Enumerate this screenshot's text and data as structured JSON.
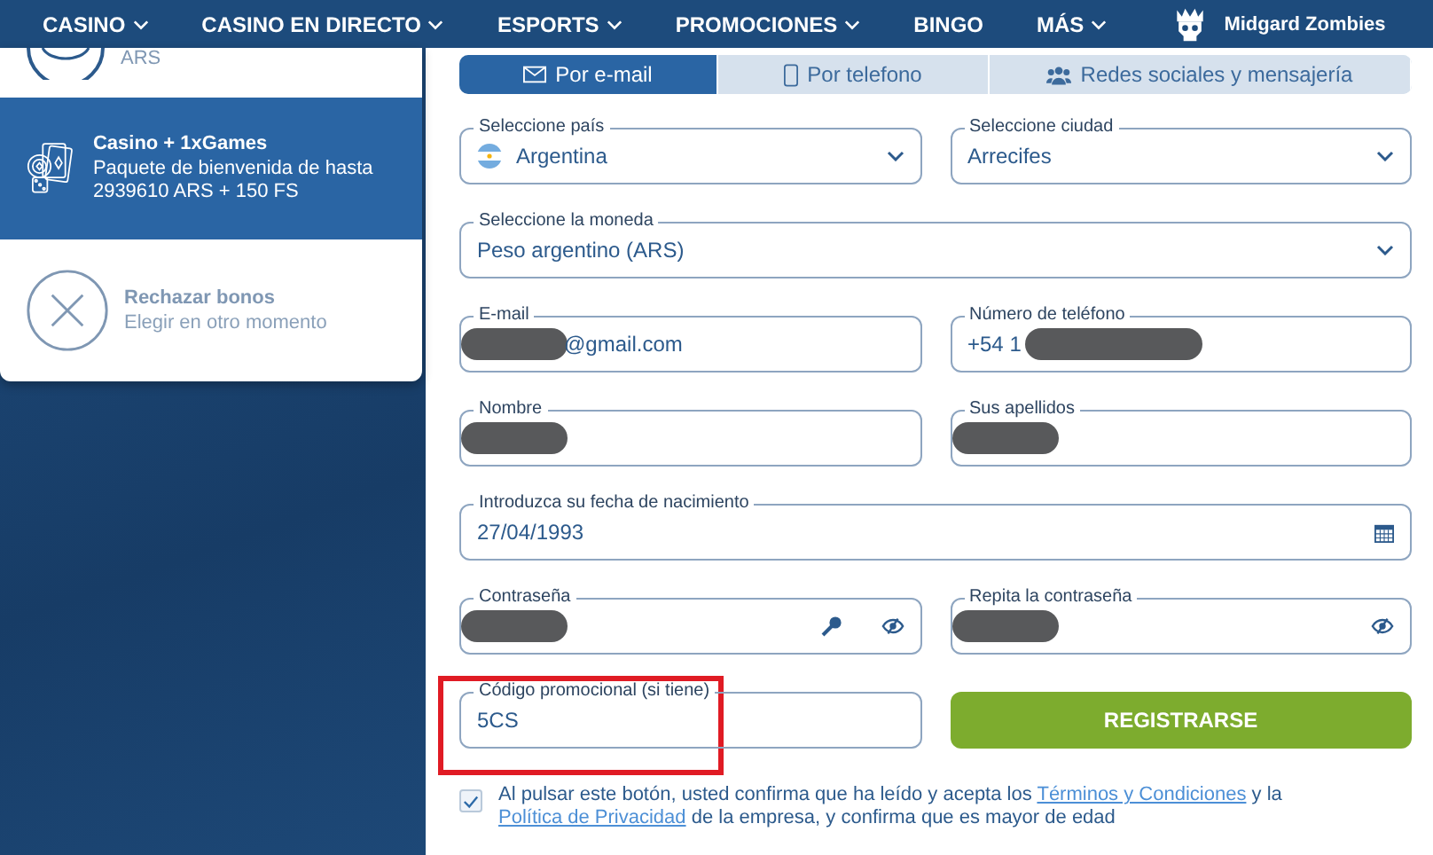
{
  "nav": {
    "items": [
      {
        "label": "CASINO",
        "dropdown": true
      },
      {
        "label": "CASINO EN DIRECTO",
        "dropdown": true
      },
      {
        "label": "ESPORTS",
        "dropdown": true
      },
      {
        "label": "PROMOCIONES",
        "dropdown": true
      },
      {
        "label": "BINGO",
        "dropdown": false
      },
      {
        "label": "MÁS",
        "dropdown": true
      }
    ],
    "brand": "Midgard Zombies"
  },
  "bonuses": [
    {
      "kind": "partial",
      "description": "ARS",
      "selected": false
    },
    {
      "kind": "casino",
      "title": "Casino + 1xGames",
      "description": "Paquete de bienvenida de hasta 2939610 ARS + 150 FS",
      "selected": true
    },
    {
      "kind": "reject",
      "title": "Rechazar bonos",
      "description": "Elegir en otro momento",
      "selected": false
    }
  ],
  "tabs": [
    {
      "kind": "email",
      "label": "Por e-mail",
      "selected": true
    },
    {
      "kind": "phone",
      "label": "Por telefono",
      "selected": false
    },
    {
      "kind": "social",
      "label": "Redes sociales y mensajería",
      "selected": false
    }
  ],
  "form_rows": [
    [
      {
        "kind": "select",
        "label": "Seleccione país",
        "value": "Argentina",
        "flag": true
      },
      {
        "kind": "select",
        "label": "Seleccione ciudad",
        "value": "Arrecifes",
        "flag": false
      }
    ],
    [
      {
        "kind": "select",
        "label": "Seleccione la moneda",
        "value": "Peso argentino (ARS)",
        "flag": false
      }
    ],
    [
      {
        "kind": "email",
        "label": "E-mail",
        "value": "@gmail.com",
        "redacted": true
      },
      {
        "kind": "phone",
        "label": "Número de teléfono",
        "value": "+54 1",
        "redacted": true
      }
    ],
    [
      {
        "kind": "text",
        "label": "Nombre",
        "redacted": true
      },
      {
        "kind": "text",
        "label": "Sus apellidos",
        "redacted": true
      }
    ],
    [
      {
        "kind": "date",
        "label": "Introduzca su fecha de nacimiento",
        "value": "27/04/1993"
      }
    ],
    [
      {
        "kind": "password",
        "label": "Contraseña",
        "redacted": true,
        "key": true
      },
      {
        "kind": "password",
        "label": "Repita la contraseña",
        "redacted": true,
        "key": false
      }
    ],
    [
      {
        "kind": "text",
        "label": "Código promocional (si tiene)",
        "value": "5CS",
        "highlighted": true
      },
      {
        "kind": "button",
        "label": "REGISTRARSE"
      }
    ]
  ],
  "consent": {
    "checked": true,
    "parts": [
      {
        "kind": "text",
        "text": "Al pulsar este botón, usted confirma que ha leído y acepta los "
      },
      {
        "kind": "link",
        "text": "Términos y Condiciones"
      },
      {
        "kind": "text",
        "text": " y la "
      },
      {
        "kind": "link",
        "text": "Política de Privacidad"
      },
      {
        "kind": "text",
        "text": " de la empresa, y confirma que es mayor de edad"
      }
    ]
  }
}
